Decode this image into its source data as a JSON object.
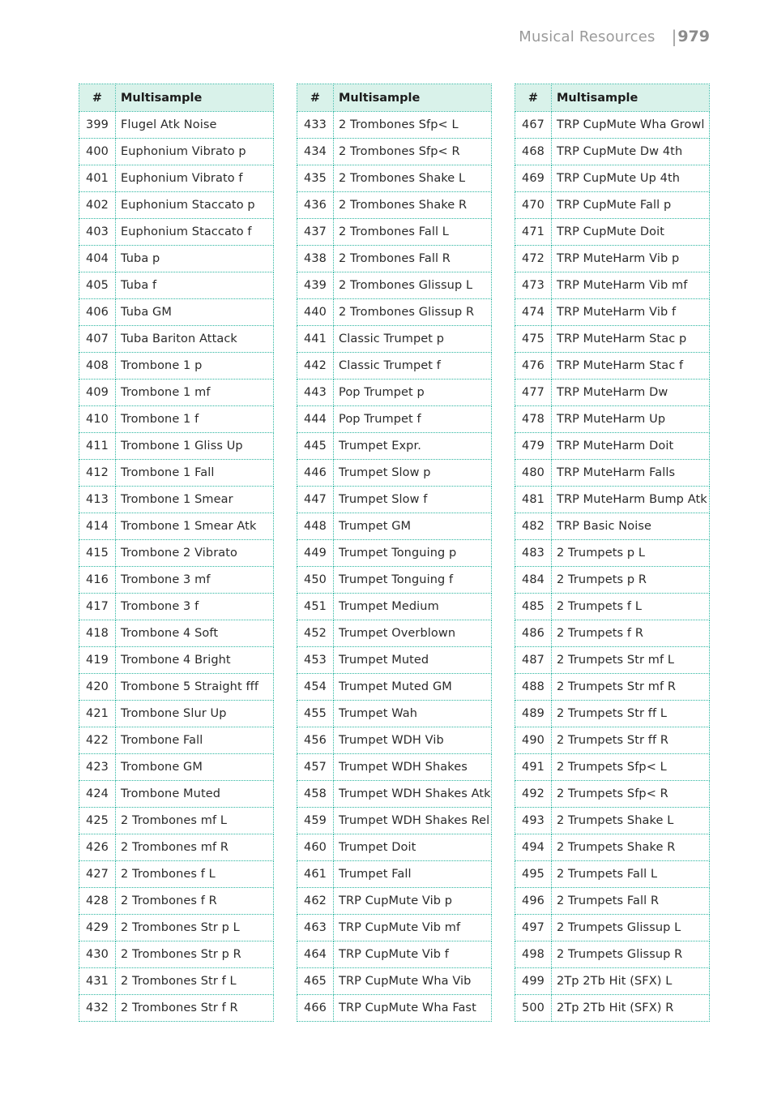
{
  "header": {
    "section": "Musical Resources",
    "separator": "|",
    "page_number": "979"
  },
  "columns": {
    "number": "#",
    "name": "Multisample"
  },
  "tables": [
    {
      "rows": [
        {
          "num": "399",
          "name": "Flugel Atk Noise"
        },
        {
          "num": "400",
          "name": "Euphonium Vibrato p"
        },
        {
          "num": "401",
          "name": "Euphonium Vibrato f"
        },
        {
          "num": "402",
          "name": "Euphonium Staccato p"
        },
        {
          "num": "403",
          "name": "Euphonium Staccato f"
        },
        {
          "num": "404",
          "name": "Tuba p"
        },
        {
          "num": "405",
          "name": "Tuba f"
        },
        {
          "num": "406",
          "name": "Tuba GM"
        },
        {
          "num": "407",
          "name": "Tuba Bariton Attack"
        },
        {
          "num": "408",
          "name": "Trombone 1 p"
        },
        {
          "num": "409",
          "name": "Trombone 1 mf"
        },
        {
          "num": "410",
          "name": "Trombone 1 f"
        },
        {
          "num": "411",
          "name": "Trombone 1 Gliss Up"
        },
        {
          "num": "412",
          "name": "Trombone 1 Fall"
        },
        {
          "num": "413",
          "name": "Trombone 1 Smear"
        },
        {
          "num": "414",
          "name": "Trombone 1 Smear Atk"
        },
        {
          "num": "415",
          "name": "Trombone 2 Vibrato"
        },
        {
          "num": "416",
          "name": "Trombone 3 mf"
        },
        {
          "num": "417",
          "name": "Trombone 3 f"
        },
        {
          "num": "418",
          "name": "Trombone 4 Soft"
        },
        {
          "num": "419",
          "name": "Trombone 4 Bright"
        },
        {
          "num": "420",
          "name": "Trombone 5 Straight fff"
        },
        {
          "num": "421",
          "name": "Trombone Slur Up"
        },
        {
          "num": "422",
          "name": "Trombone Fall"
        },
        {
          "num": "423",
          "name": "Trombone GM"
        },
        {
          "num": "424",
          "name": "Trombone Muted"
        },
        {
          "num": "425",
          "name": "2 Trombones mf L"
        },
        {
          "num": "426",
          "name": "2 Trombones mf R"
        },
        {
          "num": "427",
          "name": "2 Trombones f L"
        },
        {
          "num": "428",
          "name": "2 Trombones f R"
        },
        {
          "num": "429",
          "name": "2 Trombones Str p L"
        },
        {
          "num": "430",
          "name": "2 Trombones Str p R"
        },
        {
          "num": "431",
          "name": "2 Trombones Str f L"
        },
        {
          "num": "432",
          "name": "2 Trombones Str f R"
        }
      ]
    },
    {
      "rows": [
        {
          "num": "433",
          "name": "2 Trombones Sfp< L"
        },
        {
          "num": "434",
          "name": "2 Trombones Sfp< R"
        },
        {
          "num": "435",
          "name": "2 Trombones Shake L"
        },
        {
          "num": "436",
          "name": "2 Trombones Shake R"
        },
        {
          "num": "437",
          "name": "2 Trombones Fall L"
        },
        {
          "num": "438",
          "name": "2 Trombones Fall R"
        },
        {
          "num": "439",
          "name": "2 Trombones Glissup L"
        },
        {
          "num": "440",
          "name": "2 Trombones Glissup R"
        },
        {
          "num": "441",
          "name": "Classic Trumpet p"
        },
        {
          "num": "442",
          "name": "Classic Trumpet f"
        },
        {
          "num": "443",
          "name": "Pop Trumpet p"
        },
        {
          "num": "444",
          "name": "Pop Trumpet f"
        },
        {
          "num": "445",
          "name": "Trumpet Expr."
        },
        {
          "num": "446",
          "name": "Trumpet Slow p"
        },
        {
          "num": "447",
          "name": "Trumpet Slow f"
        },
        {
          "num": "448",
          "name": "Trumpet GM"
        },
        {
          "num": "449",
          "name": "Trumpet Tonguing p"
        },
        {
          "num": "450",
          "name": "Trumpet Tonguing f"
        },
        {
          "num": "451",
          "name": "Trumpet Medium"
        },
        {
          "num": "452",
          "name": "Trumpet Overblown"
        },
        {
          "num": "453",
          "name": "Trumpet Muted"
        },
        {
          "num": "454",
          "name": "Trumpet Muted GM"
        },
        {
          "num": "455",
          "name": "Trumpet Wah"
        },
        {
          "num": "456",
          "name": "Trumpet WDH Vib"
        },
        {
          "num": "457",
          "name": "Trumpet WDH Shakes"
        },
        {
          "num": "458",
          "name": "Trumpet WDH Shakes Atk"
        },
        {
          "num": "459",
          "name": "Trumpet WDH Shakes Rel"
        },
        {
          "num": "460",
          "name": "Trumpet Doit"
        },
        {
          "num": "461",
          "name": "Trumpet Fall"
        },
        {
          "num": "462",
          "name": "TRP CupMute Vib p"
        },
        {
          "num": "463",
          "name": "TRP CupMute Vib mf"
        },
        {
          "num": "464",
          "name": "TRP CupMute Vib f"
        },
        {
          "num": "465",
          "name": "TRP CupMute Wha Vib"
        },
        {
          "num": "466",
          "name": "TRP CupMute Wha Fast"
        }
      ]
    },
    {
      "rows": [
        {
          "num": "467",
          "name": "TRP CupMute Wha Growl"
        },
        {
          "num": "468",
          "name": "TRP CupMute Dw 4th"
        },
        {
          "num": "469",
          "name": "TRP CupMute Up 4th"
        },
        {
          "num": "470",
          "name": "TRP CupMute Fall p"
        },
        {
          "num": "471",
          "name": "TRP CupMute Doit"
        },
        {
          "num": "472",
          "name": "TRP MuteHarm Vib p"
        },
        {
          "num": "473",
          "name": "TRP MuteHarm Vib mf"
        },
        {
          "num": "474",
          "name": "TRP MuteHarm Vib f"
        },
        {
          "num": "475",
          "name": "TRP MuteHarm Stac p"
        },
        {
          "num": "476",
          "name": "TRP MuteHarm Stac f"
        },
        {
          "num": "477",
          "name": "TRP MuteHarm Dw"
        },
        {
          "num": "478",
          "name": "TRP MuteHarm Up"
        },
        {
          "num": "479",
          "name": "TRP MuteHarm Doit"
        },
        {
          "num": "480",
          "name": "TRP MuteHarm Falls"
        },
        {
          "num": "481",
          "name": "TRP MuteHarm Bump Atk"
        },
        {
          "num": "482",
          "name": "TRP Basic Noise"
        },
        {
          "num": "483",
          "name": "2 Trumpets p L"
        },
        {
          "num": "484",
          "name": "2 Trumpets p R"
        },
        {
          "num": "485",
          "name": "2 Trumpets f L"
        },
        {
          "num": "486",
          "name": "2 Trumpets f R"
        },
        {
          "num": "487",
          "name": "2 Trumpets Str mf L"
        },
        {
          "num": "488",
          "name": "2 Trumpets Str mf R"
        },
        {
          "num": "489",
          "name": "2 Trumpets Str ff L"
        },
        {
          "num": "490",
          "name": "2 Trumpets Str ff R"
        },
        {
          "num": "491",
          "name": "2 Trumpets Sfp< L"
        },
        {
          "num": "492",
          "name": "2 Trumpets Sfp< R"
        },
        {
          "num": "493",
          "name": "2 Trumpets Shake L"
        },
        {
          "num": "494",
          "name": "2 Trumpets Shake R"
        },
        {
          "num": "495",
          "name": "2 Trumpets Fall L"
        },
        {
          "num": "496",
          "name": "2 Trumpets Fall R"
        },
        {
          "num": "497",
          "name": "2 Trumpets Glissup L"
        },
        {
          "num": "498",
          "name": "2 Trumpets Glissup R"
        },
        {
          "num": "499",
          "name": "2Tp 2Tb Hit (SFX) L"
        },
        {
          "num": "500",
          "name": "2Tp 2Tb Hit (SFX) R"
        }
      ]
    }
  ],
  "colors": {
    "header_bg": "#d9f2ea",
    "border": "#2bb5a0",
    "page_header_text": "#9a9a9a"
  }
}
